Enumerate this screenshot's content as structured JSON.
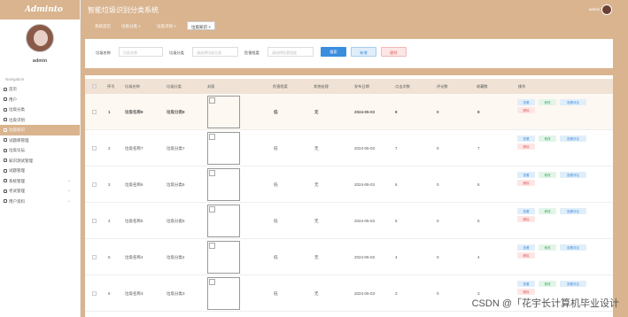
{
  "sidebar": {
    "brand": "Adminto",
    "user_name": "admin",
    "nav_title": "Navigation",
    "items": [
      {
        "label": "首页"
      },
      {
        "label": "用户"
      },
      {
        "label": "垃圾分类"
      },
      {
        "label": "垃圾识别"
      },
      {
        "label": "垃圾知识"
      },
      {
        "label": "试题库管理"
      },
      {
        "label": "垃圾论坛"
      },
      {
        "label": "知识测试管理"
      },
      {
        "label": "试题管理"
      },
      {
        "label": "系统管理"
      },
      {
        "label": "考试管理"
      },
      {
        "label": "用户资料"
      }
    ]
  },
  "header": {
    "title": "智能垃圾识别分类系统",
    "user": "admin"
  },
  "tabs": [
    {
      "label": "系统首页"
    },
    {
      "label": "垃圾分类"
    },
    {
      "label": "垃圾识别"
    },
    {
      "label": "垃圾知识"
    }
  ],
  "tab_close": "×",
  "filters": {
    "name_label": "垃圾名称",
    "name_placeholder": "垃圾名称",
    "category_label": "垃圾分类",
    "category_placeholder": "请选择垃圾分类",
    "danger_label": "危害程度",
    "danger_placeholder": "请选择危害程度",
    "search_btn": "搜索",
    "add_btn": "新增",
    "delete_btn": "删除"
  },
  "table": {
    "headers": [
      "序号",
      "垃圾名称",
      "垃圾分类",
      "封面",
      "危害程度",
      "其他处理",
      "发布日期",
      "点击次数",
      "评论数",
      "收藏数",
      "操作"
    ],
    "rows": [
      {
        "idx": "1",
        "name": "垃圾名称8",
        "cat": "垃圾分类8",
        "danger": "低",
        "other": "无",
        "date": "2024-05-03",
        "clicks": "8",
        "comments": "0",
        "favs": "8"
      },
      {
        "idx": "2",
        "name": "垃圾名称7",
        "cat": "垃圾分类7",
        "danger": "低",
        "other": "无",
        "date": "2024-05-03",
        "clicks": "7",
        "comments": "0",
        "favs": "7"
      },
      {
        "idx": "3",
        "name": "垃圾名称6",
        "cat": "垃圾分类6",
        "danger": "低",
        "other": "无",
        "date": "2024-05-03",
        "clicks": "6",
        "comments": "0",
        "favs": "6"
      },
      {
        "idx": "4",
        "name": "垃圾名称5",
        "cat": "垃圾分类5",
        "danger": "低",
        "other": "无",
        "date": "2024-05-03",
        "clicks": "5",
        "comments": "0",
        "favs": "5"
      },
      {
        "idx": "5",
        "name": "垃圾名称4",
        "cat": "垃圾分类4",
        "danger": "低",
        "other": "无",
        "date": "2024-05-03",
        "clicks": "4",
        "comments": "0",
        "favs": "4"
      },
      {
        "idx": "6",
        "name": "垃圾名称3",
        "cat": "垃圾分类3",
        "danger": "低",
        "other": "无",
        "date": "2024-05-03",
        "clicks": "3",
        "comments": "0",
        "favs": "3"
      }
    ],
    "actions": {
      "view": "查看",
      "edit": "修改",
      "view_comments": "查看评论",
      "delete": "删除"
    }
  },
  "watermark": "CSDN @「花宇长计算机毕业设计"
}
